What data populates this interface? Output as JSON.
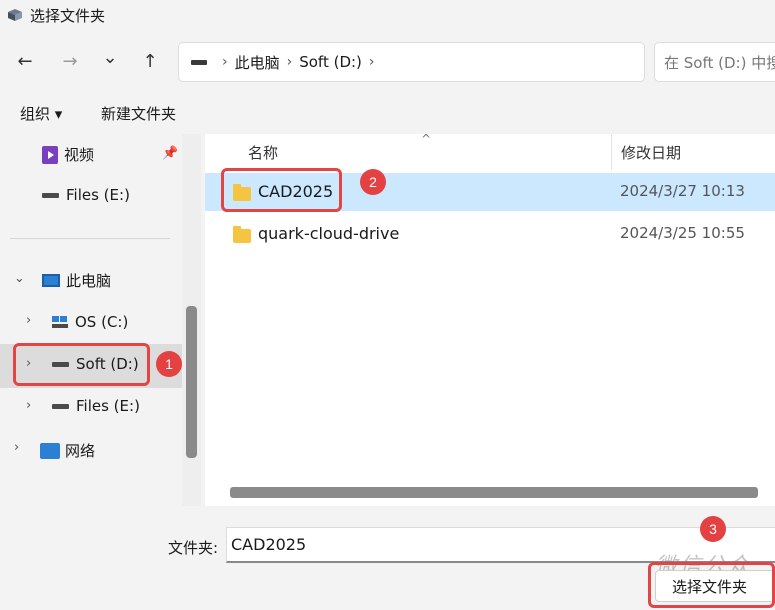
{
  "titlebar": {
    "title": "选择文件夹"
  },
  "nav": {
    "back": "←",
    "forward": "→",
    "recent": "⌄",
    "up": "↑"
  },
  "address": {
    "crumbs": [
      "此电脑",
      "Soft (D:)"
    ],
    "sep": "›",
    "dropdown": "⌄",
    "refresh": "↻"
  },
  "search": {
    "placeholder": "在 Soft (D:) 中搜"
  },
  "commandbar": {
    "organize": "组织 ▾",
    "new_folder": "新建文件夹"
  },
  "sidebar": {
    "items": [
      {
        "label": "视频"
      },
      {
        "label": "Files (E:)"
      },
      {
        "label": "此电脑"
      },
      {
        "label": "OS (C:)"
      },
      {
        "label": "Soft (D:)"
      },
      {
        "label": "Files (E:)"
      },
      {
        "label": "网络"
      }
    ],
    "expanded_chevron": "⌄",
    "collapsed_chevron": "›",
    "pin": "📌"
  },
  "filelist": {
    "columns": {
      "name": "名称",
      "modified": "修改日期"
    },
    "sort_caret": "^",
    "rows": [
      {
        "name": "CAD2025",
        "modified": "2024/3/27 10:13",
        "selected": true
      },
      {
        "name": "quark-cloud-drive",
        "modified": "2024/3/25 10:55",
        "selected": false
      }
    ]
  },
  "annotations": {
    "badge1": "1",
    "badge2": "2",
    "badge3": "3",
    "accent": "#e24545"
  },
  "footer": {
    "folder_label": "文件夹:",
    "folder_value": "CAD2025",
    "select_button": "选择文件夹",
    "watermark": "微信公众"
  }
}
